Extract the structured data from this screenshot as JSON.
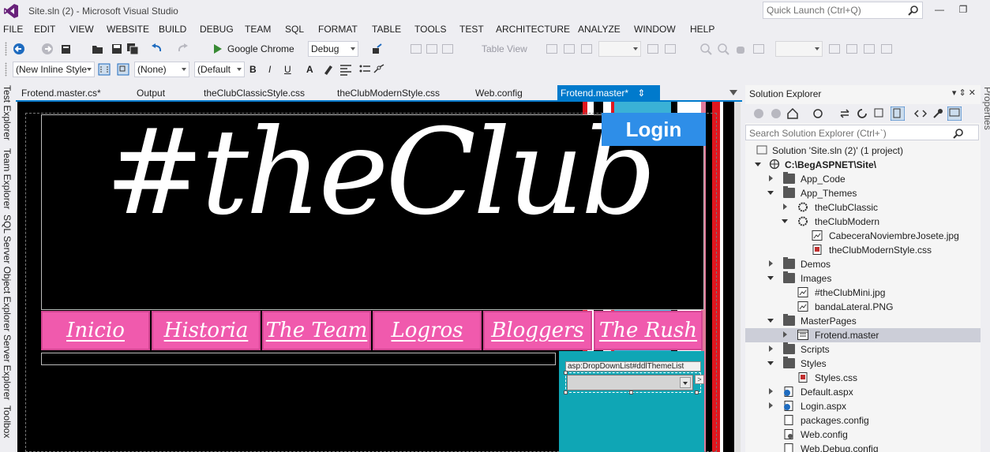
{
  "window": {
    "title": "Site.sln (2) - Microsoft Visual Studio",
    "quick_launch_placeholder": "Quick Launch (Ctrl+Q)"
  },
  "menu": [
    "FILE",
    "EDIT",
    "VIEW",
    "WEBSITE",
    "BUILD",
    "DEBUG",
    "TEAM",
    "SQL",
    "FORMAT",
    "TABLE",
    "TOOLS",
    "TEST",
    "ARCHITECTURE",
    "ANALYZE",
    "WINDOW",
    "HELP"
  ],
  "toolbar1": {
    "run_target": "Google Chrome",
    "configuration": "Debug",
    "table_view": "Table View"
  },
  "toolbar2": {
    "style_combo": "(New Inline Style",
    "block_format": "(None)",
    "font_combo": "(Default",
    "bold": "B",
    "italic": "I",
    "underline": "U",
    "font_color": "A"
  },
  "left_tools": [
    "Test Explorer",
    "Team Explorer",
    "SQL Server Object Explorer",
    "Server Explorer",
    "Toolbox"
  ],
  "right_tools": [
    "Properties"
  ],
  "doc_tabs": [
    {
      "label": "Frotend.master.cs*",
      "active": false
    },
    {
      "label": "Output",
      "active": false
    },
    {
      "label": "theClubClassicStyle.css",
      "active": false
    },
    {
      "label": "theClubModernStyle.css",
      "active": false
    },
    {
      "label": "Web.config",
      "active": false
    },
    {
      "label": "Frotend.master*",
      "active": true
    }
  ],
  "design": {
    "logo_text": "#theClub",
    "login_label": "Login",
    "nav": [
      "Inicio",
      "Historia",
      "The Team",
      "Logros",
      "Bloggers",
      "The Rush"
    ],
    "dropdown_tag": "asp:DropDownList#ddlThemeList",
    "smart_tag": ">"
  },
  "solution_explorer": {
    "title": "Solution Explorer",
    "search_placeholder": "Search Solution Explorer (Ctrl+`)",
    "tree": [
      {
        "label": "Solution 'Site.sln (2)' (1 project)",
        "depth": 0,
        "icon": "solution-icon",
        "expander": "none"
      },
      {
        "label": "C:\\BegASPNET\\Site\\",
        "depth": 1,
        "icon": "website-icon",
        "expander": "expanded",
        "bold": true
      },
      {
        "label": "App_Code",
        "depth": 2,
        "icon": "folder-icon",
        "expander": "collapsed"
      },
      {
        "label": "App_Themes",
        "depth": 2,
        "icon": "folder-icon",
        "expander": "expanded"
      },
      {
        "label": "theClubClassic",
        "depth": 3,
        "icon": "theme-icon",
        "expander": "collapsed"
      },
      {
        "label": "theClubModern",
        "depth": 3,
        "icon": "theme-icon",
        "expander": "expanded"
      },
      {
        "label": "CabeceraNoviembreJosete.jpg",
        "depth": 4,
        "icon": "image-file-icon",
        "expander": "none"
      },
      {
        "label": "theClubModernStyle.css",
        "depth": 4,
        "icon": "css-file-icon",
        "expander": "none"
      },
      {
        "label": "Demos",
        "depth": 2,
        "icon": "folder-icon",
        "expander": "collapsed"
      },
      {
        "label": "Images",
        "depth": 2,
        "icon": "folder-icon",
        "expander": "expanded"
      },
      {
        "label": "#theClubMini.jpg",
        "depth": 3,
        "icon": "image-file-icon",
        "expander": "none"
      },
      {
        "label": "bandaLateral.PNG",
        "depth": 3,
        "icon": "image-file-icon",
        "expander": "none"
      },
      {
        "label": "MasterPages",
        "depth": 2,
        "icon": "folder-icon",
        "expander": "expanded"
      },
      {
        "label": "Frotend.master",
        "depth": 3,
        "icon": "master-page-icon",
        "expander": "collapsed",
        "selected": true
      },
      {
        "label": "Scripts",
        "depth": 2,
        "icon": "folder-icon",
        "expander": "collapsed"
      },
      {
        "label": "Styles",
        "depth": 2,
        "icon": "folder-icon",
        "expander": "expanded"
      },
      {
        "label": "Styles.css",
        "depth": 3,
        "icon": "css-file-icon",
        "expander": "none"
      },
      {
        "label": "Default.aspx",
        "depth": 2,
        "icon": "aspx-file-icon",
        "expander": "collapsed"
      },
      {
        "label": "Login.aspx",
        "depth": 2,
        "icon": "aspx-file-icon",
        "expander": "collapsed"
      },
      {
        "label": "packages.config",
        "depth": 2,
        "icon": "config-file-icon",
        "expander": "none"
      },
      {
        "label": "Web.config",
        "depth": 2,
        "icon": "config-file-icon",
        "expander": "none"
      },
      {
        "label": "Web.Debug.config",
        "depth": 2,
        "icon": "config-file-icon",
        "expander": "none"
      }
    ]
  },
  "colors": {
    "accent": "#007acc",
    "login_button": "#2e8ee8",
    "nav_pink": "#f05aad",
    "teal_panel": "#0fa6b5"
  }
}
